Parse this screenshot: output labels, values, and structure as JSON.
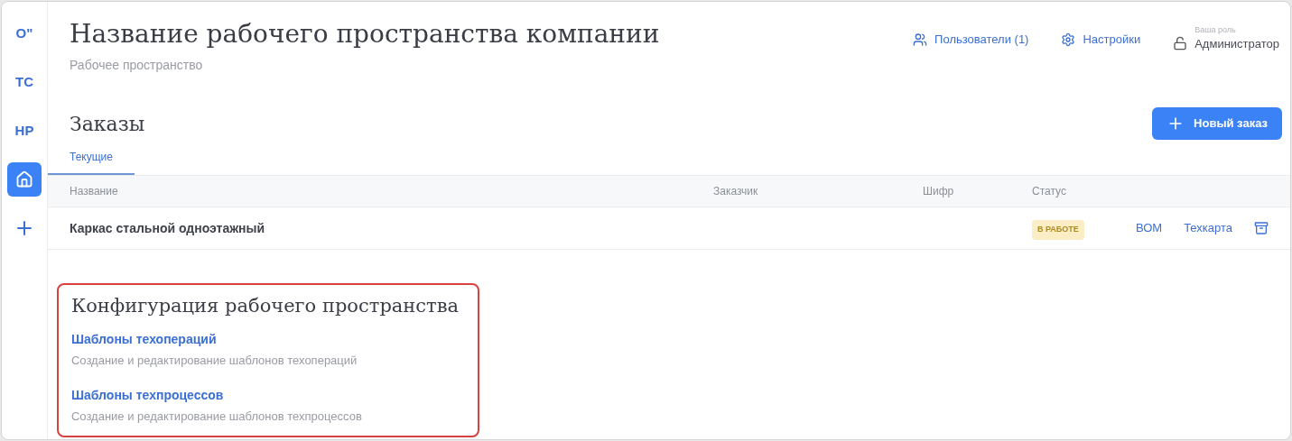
{
  "sidebar": {
    "items": [
      {
        "kind": "text",
        "label": "О\"",
        "selected": false
      },
      {
        "kind": "text",
        "label": "ТС",
        "selected": false
      },
      {
        "kind": "text",
        "label": "НР",
        "selected": false
      },
      {
        "kind": "home",
        "selected": true
      },
      {
        "kind": "add",
        "selected": false
      }
    ]
  },
  "header": {
    "title": "Название рабочего пространства компании",
    "subtitle": "Рабочее пространство",
    "users_link": "Пользователи (1)",
    "settings_link": "Настройки",
    "role_caption": "Ваша роль",
    "role": "Администратор"
  },
  "orders": {
    "title": "Заказы",
    "new_button": "Новый заказ",
    "tabs": [
      {
        "label": "Текущие",
        "selected": true
      }
    ],
    "table": {
      "columns": [
        "Название",
        "Заказчик",
        "Шифр",
        "Статус"
      ],
      "rows": [
        {
          "name": "Каркас стальной одноэтажный",
          "status": "В РАБОТЕ",
          "links": [
            "ВОМ",
            "Техкарта"
          ]
        }
      ]
    }
  },
  "configuration": {
    "title": "Конфигурация рабочего пространства",
    "highlighted": true,
    "items": [
      {
        "title": "Шаблоны техопераций",
        "description": "Создание и редактирование шаблонов техопераций"
      },
      {
        "title": "Шаблоны техпроцессов",
        "description": "Создание и редактирование шаблонов техпроцессов"
      }
    ]
  }
}
